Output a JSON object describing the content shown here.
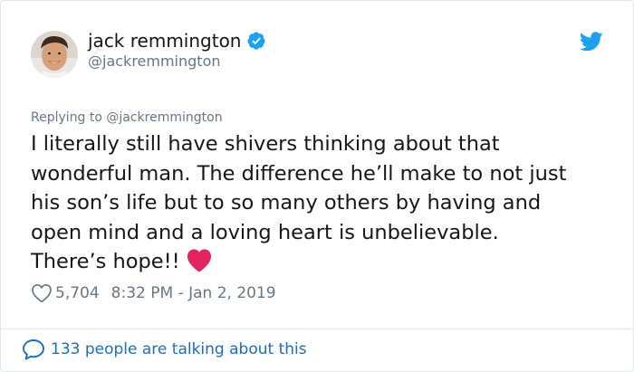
{
  "tweet": {
    "author": {
      "display_name": "jack remmington",
      "handle": "@jackremmington",
      "verified": true
    },
    "replying_prefix": "Replying to ",
    "replying_to": "@jackremmington",
    "text": "I literally still have shivers thinking about that\nwonderful man. The difference he’ll make to not just\nhis son’s life but to so many others by having and\nopen mind and a loving heart is unbelievable.\nThere’s hope!!",
    "trailing_emoji": "red-heart",
    "likes": "5,704",
    "timestamp": "8:32 PM - Jan 2, 2019"
  },
  "footer": {
    "conversation_text": "133 people are talking about this"
  },
  "icons": {
    "verified": "verified-badge-icon",
    "brand": "twitter-bird-icon",
    "like": "heart-outline-icon",
    "conversation": "speech-bubble-icon"
  },
  "colors": {
    "brand_blue": "#1da1f2",
    "link_blue": "#1b6fb8",
    "secondary_text": "#657786",
    "heart_red": "#e0245e",
    "border": "#e1e8ed"
  }
}
